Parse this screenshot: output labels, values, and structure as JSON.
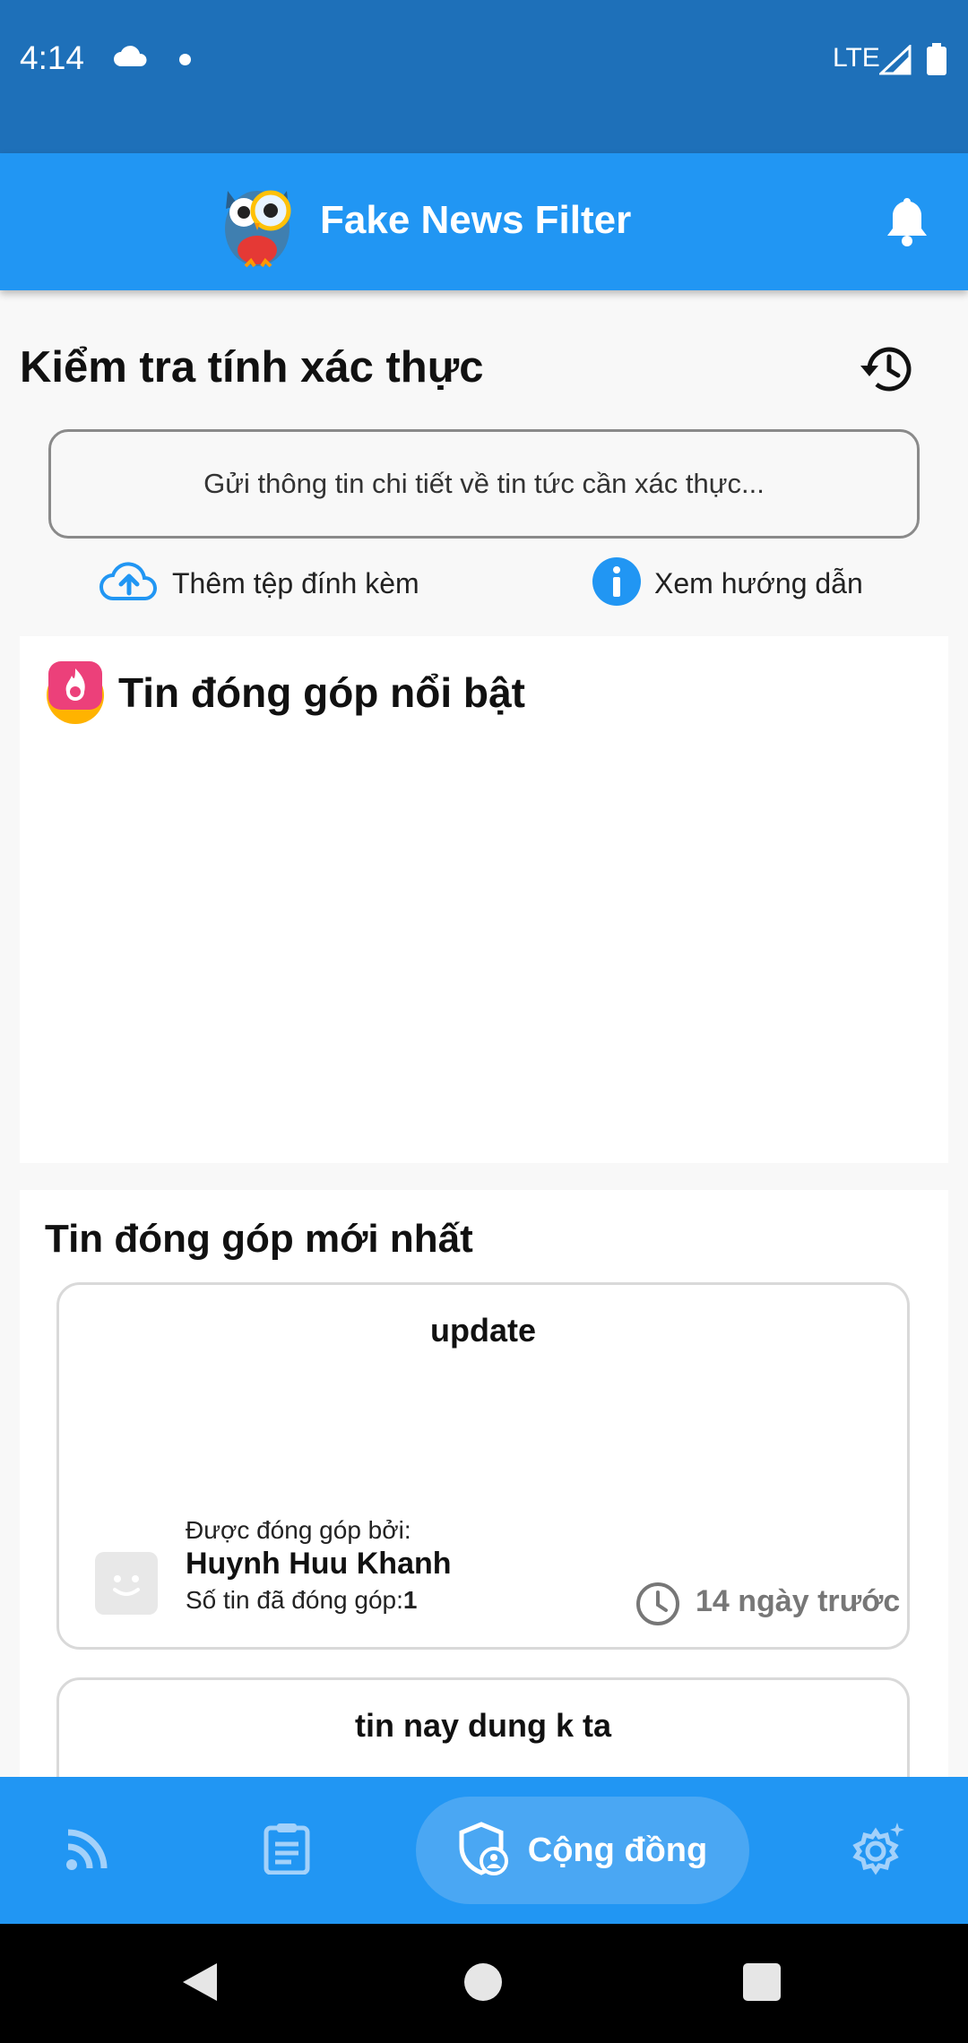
{
  "status_bar": {
    "time": "4:14",
    "network": "LTE",
    "icons": [
      "cloud-icon",
      "dot-icon",
      "signal-icon",
      "battery-icon"
    ]
  },
  "app_bar": {
    "title": "Fake News Filter",
    "icons": [
      "owl-logo-icon",
      "bell-icon"
    ]
  },
  "verify": {
    "title": "Kiểm tra tính xác thực",
    "input_placeholder": "Gửi thông tin chi tiết về tin tức cần xác thực...",
    "attach_label": "Thêm tệp đính kèm",
    "guide_label": "Xem hướng dẫn"
  },
  "featured": {
    "title": "Tin đóng góp nổi bật"
  },
  "latest": {
    "title": "Tin đóng góp mới nhất",
    "cards": [
      {
        "title": "update",
        "contributed_by_label": "Được đóng góp bởi:",
        "contributor": "Huynh Huu Khanh",
        "count_label": "Số tin đã đóng góp:",
        "count": "1",
        "time_ago": "14 ngày trước"
      },
      {
        "title": "tin nay dung k ta"
      }
    ]
  },
  "bottom_nav": {
    "items": [
      {
        "icon": "rss-icon"
      },
      {
        "icon": "clipboard-icon"
      },
      {
        "icon": "shield-user-icon",
        "label": "Cộng đồng",
        "active": true
      },
      {
        "icon": "settings-gear-icon"
      }
    ]
  },
  "colors": {
    "status_bar": "#1e70b9",
    "primary": "#2196f3",
    "active_pill": "#4aa7f3",
    "background": "#f8f8f8"
  }
}
